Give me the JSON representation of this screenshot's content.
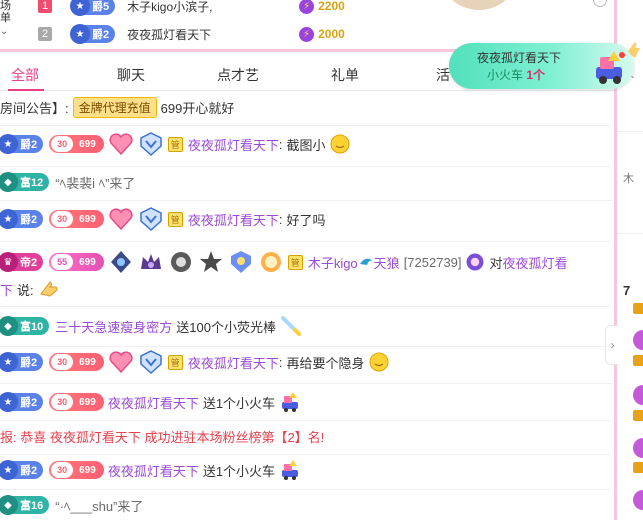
{
  "top_ranks": {
    "side_label_1": "场",
    "side_label_2": "单",
    "rows": [
      {
        "rank": "1",
        "level": "爵5",
        "name": "木子kigo小滨子,",
        "coins": "2200"
      },
      {
        "rank": "2",
        "level": "爵2",
        "name": "夜夜孤灯看天下",
        "coins": "2000"
      }
    ]
  },
  "toast": {
    "name": "夜夜孤灯看天下",
    "gift_prefix": "小火车",
    "gift_count": "1个"
  },
  "tabs": [
    "全部",
    "聊天",
    "点才艺",
    "礼单",
    "活"
  ],
  "chat": {
    "notice": {
      "label": "房间公告】:",
      "button": "金牌代理充值",
      "text": "699开心就好"
    },
    "messages": [
      {
        "level": "爵2",
        "fans_lv": "30",
        "fans": "699",
        "name": "夜夜孤灯看天下",
        "colon": ":",
        "text": "截图小"
      },
      {
        "level": "富12",
        "entry_text": "“ﾍ裴裴i ﾍ”来了"
      },
      {
        "level": "爵2",
        "fans_lv": "30",
        "fans": "699",
        "name": "夜夜孤灯看天下",
        "colon": ":",
        "text": "好了吗"
      },
      {
        "level": "帝2",
        "fans_lv": "55",
        "fans": "699",
        "name": "木子kigo",
        "name2": "天狼",
        "room_id": "[7252739]",
        "to": "对",
        "target": "夜夜孤灯看",
        "line2_target": "下",
        "line2_text": "说:"
      },
      {
        "level": "富10",
        "name": "三十天急速瘦身密方",
        "text": "送100个小荧光棒"
      },
      {
        "level": "爵2",
        "fans_lv": "30",
        "fans": "699",
        "name": "夜夜孤灯看天下",
        "colon": ":",
        "text": "再给要个隐身"
      },
      {
        "level": "爵2",
        "fans_lv": "30",
        "fans": "699",
        "name": "夜夜孤灯看天下",
        "text": "送1个小火车"
      },
      {
        "system": "报: 恭喜 夜夜孤灯看天下 成功进驻本场粉丝榜第【2】名!"
      },
      {
        "level": "爵2",
        "fans_lv": "30",
        "fans": "699",
        "name": "夜夜孤灯看天下",
        "text": "送1个小火车"
      },
      {
        "level": "富16",
        "entry_text": "“·ﾍ___shu”来了"
      }
    ]
  },
  "right_panel": {
    "label_1": "木",
    "label_2": "木",
    "label_3": "7"
  }
}
